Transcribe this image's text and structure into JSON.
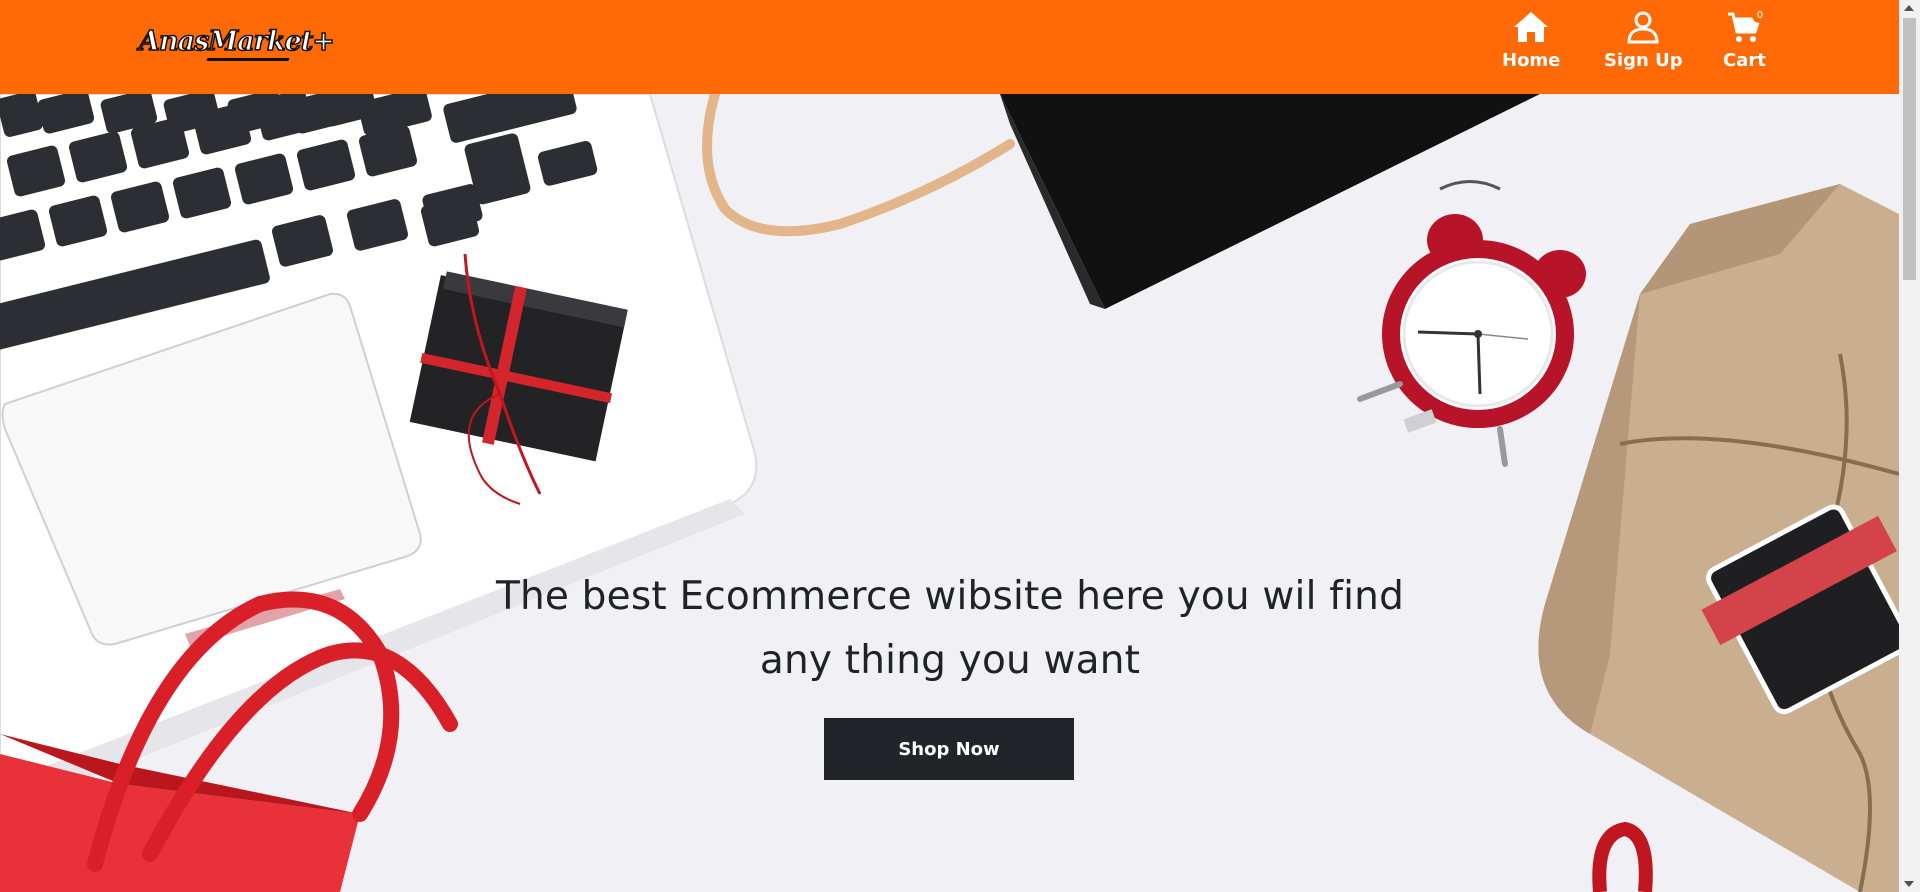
{
  "brand": {
    "logo_text": "AnasMarket+"
  },
  "nav": {
    "items": [
      {
        "label": "Home",
        "icon": "home-icon"
      },
      {
        "label": "Sign Up",
        "icon": "user-icon"
      },
      {
        "label": "Cart",
        "icon": "cart-icon"
      }
    ],
    "cart_count": "0"
  },
  "hero": {
    "title_line1": "The best Ecommerce wibsite here you wil find",
    "title_line2": "any thing you want",
    "cta_label": "Shop Now"
  },
  "colors": {
    "navbar_bg": "#ff6a07",
    "button_bg": "#212529",
    "hero_bg": "#f1f0f4"
  }
}
